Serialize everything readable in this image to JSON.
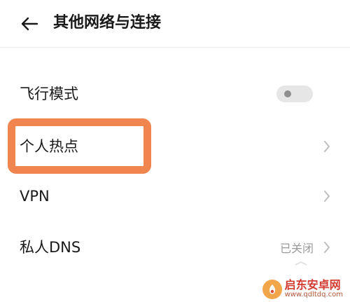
{
  "header": {
    "title": "其他网络与连接",
    "back_icon": "arrow-left-icon"
  },
  "rows": [
    {
      "label": "飞行模式",
      "control": "toggle",
      "toggle_on": false
    },
    {
      "label": "个人热点",
      "control": "chevron",
      "highlighted": true
    },
    {
      "label": "VPN",
      "control": "chevron"
    },
    {
      "label": "私人DNS",
      "control": "chevron",
      "value": "已关闭"
    }
  ],
  "icons": {
    "chevron": "chevron-right-icon"
  },
  "colors": {
    "highlight": "#f0854f",
    "secondary_text": "#9a9a9a",
    "toggle_track": "#e6e6e6",
    "watermark_red": "#d23a2f"
  },
  "watermark": {
    "name": "启东安卓网",
    "url": "www.qdltdq.com"
  }
}
